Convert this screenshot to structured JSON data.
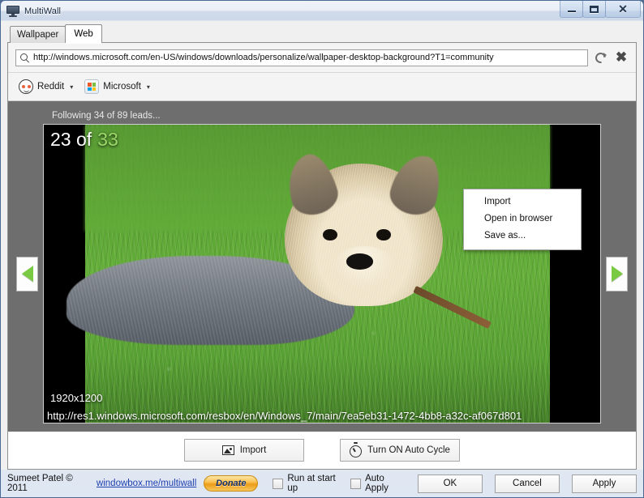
{
  "window": {
    "title": "MultiWall",
    "app_icon": "monitor-icon",
    "controls": {
      "minimize": "minimize-icon",
      "maximize": "maximize-icon",
      "close": "close-icon"
    }
  },
  "tabs": [
    {
      "label": "Wallpaper",
      "active": false
    },
    {
      "label": "Web",
      "active": true
    }
  ],
  "urlbar": {
    "search_icon": "search-icon",
    "url": "http://windows.microsoft.com/en-US/windows/downloads/personalize/wallpaper-desktop-background?T1=community",
    "placeholder": "Enter URL",
    "refresh_icon": "refresh-icon",
    "stop_icon": "close-x-icon"
  },
  "bookmarks": [
    {
      "label": "Reddit",
      "icon": "reddit-icon",
      "caret": "▾"
    },
    {
      "label": "Microsoft",
      "icon": "windows-logo-icon",
      "caret": "▾"
    }
  ],
  "viewer": {
    "status": "Following 34 of 89 leads...",
    "prev_arrow": "previous-arrow-icon",
    "next_arrow": "next-arrow-icon",
    "counter_current": "23 of",
    "counter_total": "33",
    "dimensions": "1920x1200",
    "image_url": "http://res1.windows.microsoft.com/resbox/en/Windows_7/main/7ea5eb31-1472-4bb8-a32c-af067d801"
  },
  "context_menu": {
    "items": [
      "Import",
      "Open in browser",
      "Save as..."
    ]
  },
  "actions": {
    "import": {
      "label": "Import",
      "icon": "picture-icon"
    },
    "auto_cycle": {
      "label": "Turn ON Auto Cycle",
      "icon": "timer-icon"
    }
  },
  "footer": {
    "copyright": "Sumeet Patel © 2011",
    "link": "windowbox.me/multiwall",
    "donate": "Donate",
    "checkboxes": [
      {
        "label": "Run at start up",
        "checked": false
      },
      {
        "label": "Auto Apply",
        "checked": false
      }
    ],
    "buttons": [
      "OK",
      "Cancel",
      "Apply"
    ]
  },
  "colors": {
    "accent_green": "#7ac943",
    "link_blue": "#1f3fb0",
    "viewer_bg": "#6e6e6e",
    "donate_orange": "#ec9b16"
  }
}
